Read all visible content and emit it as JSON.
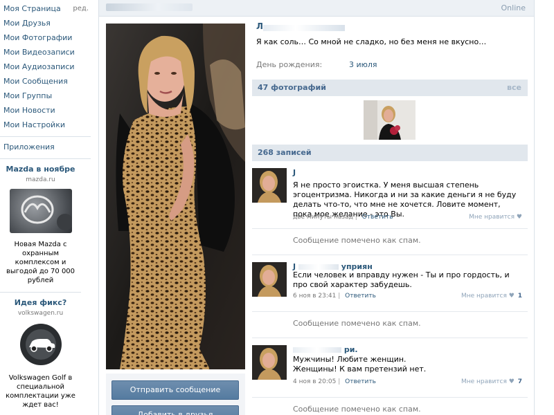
{
  "menu": {
    "items": [
      {
        "label": "Моя Страница",
        "edit": "ред."
      },
      {
        "label": "Мои Друзья"
      },
      {
        "label": "Мои Фотографии"
      },
      {
        "label": "Мои Видеозаписи"
      },
      {
        "label": "Мои Аудиозаписи"
      },
      {
        "label": "Мои Сообщения"
      },
      {
        "label": "Мои Группы"
      },
      {
        "label": "Мои Новости"
      },
      {
        "label": "Мои Настройки"
      }
    ],
    "apps": "Приложения"
  },
  "ads": [
    {
      "title": "Mazda в ноябре",
      "domain": "mazda.ru",
      "text": "Новая Mazda с охранным комплексом и выгодой до 70 000 рублей",
      "icon": "mazda-logo"
    },
    {
      "title": "Идея фикс?",
      "domain": "volkswagen.ru",
      "text": "Volkswagen Golf в специальной комплектации уже ждет вас!",
      "icon": "car-icon"
    }
  ],
  "header": {
    "status": "Online"
  },
  "profile": {
    "name_fragment": "Л",
    "status_text": "Я как соль… Со мной не сладко, но без меня не вкусно…",
    "birthday_label": "День рождения:",
    "birthday_value": "3 июля"
  },
  "buttons": {
    "send_message": "Отправить сообщение",
    "add_friend": "Добавить в друзья"
  },
  "photos": {
    "count_label": "47 фотографий",
    "all_label": "все"
  },
  "wall": {
    "count_label": "268 записей",
    "posts": [
      {
        "author_fragment": "J",
        "text": "Я не просто эгоистка. У меня высшая степень эгоцентризма. Никогда и ни за какие деньги я не буду делать что-то, что мне не хочется. Ловите момент, пока мое желание - это Вы.",
        "time": "две минуты назад",
        "reply": "Ответить",
        "like": "Мне нравится",
        "likes": ""
      },
      {
        "author_fragment": "J",
        "author_tail": "уприян",
        "text": "Если человек и вправду нужен - Ты и про гордость, и про свой характер забудешь.",
        "time": "6 ноя в 23:41",
        "reply": "Ответить",
        "like": "Мне нравится",
        "likes": "1"
      },
      {
        "author_fragment": "",
        "author_tail": "ри.",
        "text": "Мужчины! Любите женщин.\nЖенщины! К вам претензий нет.",
        "time": "4 ноя в 20:05",
        "reply": "Ответить",
        "like": "Мне нравится",
        "likes": "7"
      }
    ],
    "spam_notice": "Сообщение помечено как спам."
  },
  "colors": {
    "link": "#2b587a",
    "bar": "#e1e7ed",
    "button": "#557ba0"
  }
}
